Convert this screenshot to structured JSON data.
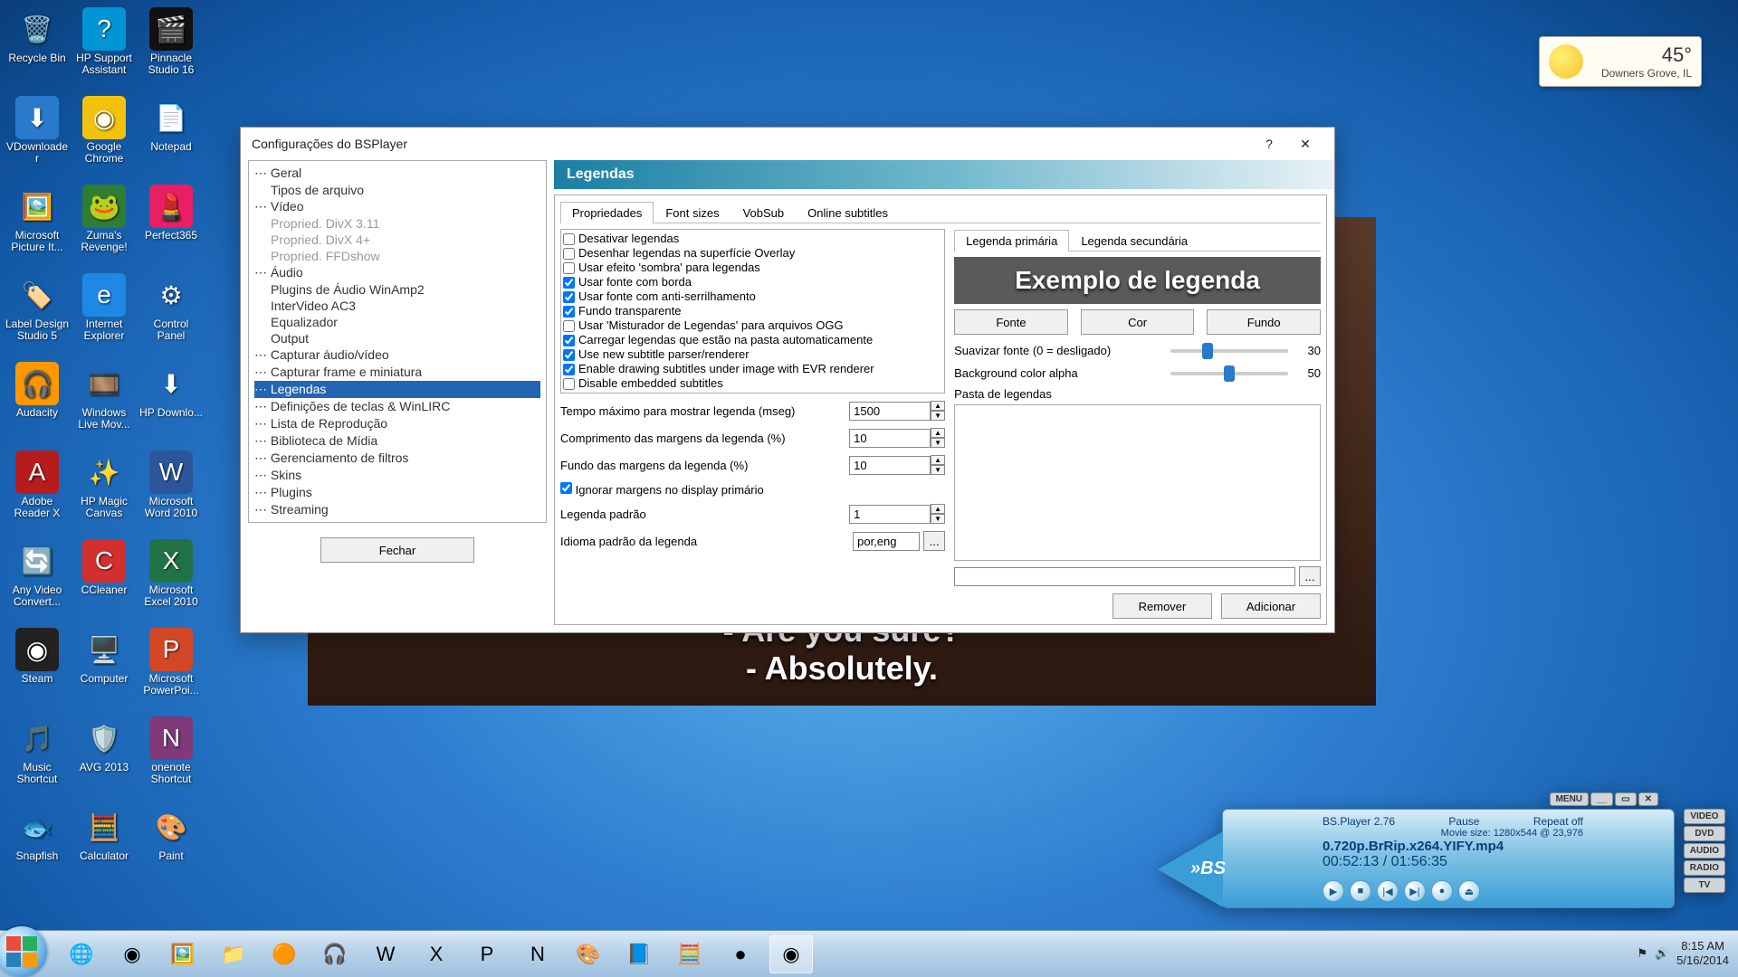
{
  "weather": {
    "temp": "45°",
    "loc": "Downers Grove, IL"
  },
  "desktop_icons": [
    {
      "label": "Recycle Bin",
      "glyph": "🗑️",
      "bg": ""
    },
    {
      "label": "HP Support Assistant",
      "glyph": "?",
      "bg": "#0096d6"
    },
    {
      "label": "Pinnacle Studio 16",
      "glyph": "🎬",
      "bg": "#111"
    },
    {
      "label": "VDownloader",
      "glyph": "⬇",
      "bg": "#2a7acc"
    },
    {
      "label": "Google Chrome",
      "glyph": "◉",
      "bg": "#f4c20d"
    },
    {
      "label": "Notepad",
      "glyph": "📄",
      "bg": ""
    },
    {
      "label": "Microsoft Picture It...",
      "glyph": "🖼️",
      "bg": ""
    },
    {
      "label": "Zuma's Revenge!",
      "glyph": "🐸",
      "bg": "#2e7d32"
    },
    {
      "label": "Perfect365",
      "glyph": "💄",
      "bg": "#e91e63"
    },
    {
      "label": "Label Design Studio 5",
      "glyph": "🏷️",
      "bg": ""
    },
    {
      "label": "Internet Explorer",
      "glyph": "e",
      "bg": "#1e88e5"
    },
    {
      "label": "Control Panel",
      "glyph": "⚙",
      "bg": ""
    },
    {
      "label": "Audacity",
      "glyph": "🎧",
      "bg": "#ff9800"
    },
    {
      "label": "Windows Live Mov...",
      "glyph": "🎞️",
      "bg": ""
    },
    {
      "label": "HP Downlo...",
      "glyph": "⬇",
      "bg": ""
    },
    {
      "label": "Adobe Reader X",
      "glyph": "A",
      "bg": "#b71c1c"
    },
    {
      "label": "HP Magic Canvas",
      "glyph": "✨",
      "bg": ""
    },
    {
      "label": "Microsoft Word 2010",
      "glyph": "W",
      "bg": "#2b579a"
    },
    {
      "label": "Any Video Convert...",
      "glyph": "🔄",
      "bg": ""
    },
    {
      "label": "CCleaner",
      "glyph": "C",
      "bg": "#d32f2f"
    },
    {
      "label": "Microsoft Excel 2010",
      "glyph": "X",
      "bg": "#217346"
    },
    {
      "label": "Steam",
      "glyph": "◉",
      "bg": "#222"
    },
    {
      "label": "Computer",
      "glyph": "🖥️",
      "bg": ""
    },
    {
      "label": "Microsoft PowerPoi...",
      "glyph": "P",
      "bg": "#d24726"
    },
    {
      "label": "Music Shortcut",
      "glyph": "🎵",
      "bg": ""
    },
    {
      "label": "AVG 2013",
      "glyph": "🛡️",
      "bg": ""
    },
    {
      "label": "onenote Shortcut",
      "glyph": "N",
      "bg": "#80397b"
    },
    {
      "label": "Snapfish",
      "glyph": "🐟",
      "bg": ""
    },
    {
      "label": "Calculator",
      "glyph": "🧮",
      "bg": ""
    },
    {
      "label": "Paint",
      "glyph": "🎨",
      "bg": ""
    }
  ],
  "video": {
    "sub1": "- Are you sure?",
    "sub2": "- Absolutely."
  },
  "dialog": {
    "title": "Configurações do BSPlayer",
    "help": "?",
    "close": "✕",
    "tree": [
      {
        "t": "Geral",
        "i": 0
      },
      {
        "t": "Tipos de arquivo",
        "i": 1
      },
      {
        "t": "Vídeo",
        "i": 0
      },
      {
        "t": "Propried. DivX 3.11",
        "i": 1,
        "d": 1
      },
      {
        "t": "Propried. DivX 4+",
        "i": 1,
        "d": 1
      },
      {
        "t": "Propried. FFDshow",
        "i": 1,
        "d": 1
      },
      {
        "t": "Áudio",
        "i": 0
      },
      {
        "t": "Plugins de Áudio WinAmp2",
        "i": 1
      },
      {
        "t": "InterVideo AC3",
        "i": 1
      },
      {
        "t": "Equalizador",
        "i": 1
      },
      {
        "t": "Output",
        "i": 1
      },
      {
        "t": "Capturar áudio/vídeo",
        "i": 0
      },
      {
        "t": "Capturar frame e miniatura",
        "i": 0
      },
      {
        "t": "Legendas",
        "i": 0,
        "sel": 1
      },
      {
        "t": "Definições de teclas & WinLIRC",
        "i": 0
      },
      {
        "t": "Lista de Reprodução",
        "i": 0
      },
      {
        "t": "Biblioteca de Mídia",
        "i": 0
      },
      {
        "t": "Gerenciamento de filtros",
        "i": 0
      },
      {
        "t": "Skins",
        "i": 0
      },
      {
        "t": "Plugins",
        "i": 0
      },
      {
        "t": "Streaming",
        "i": 0
      }
    ],
    "close_btn": "Fechar",
    "banner": "Legendas",
    "tabs": [
      "Propriedades",
      "Font sizes",
      "VobSub",
      "Online subtitles"
    ],
    "checks": [
      {
        "t": "Desativar legendas",
        "c": 0
      },
      {
        "t": "Desenhar legendas na superfície Overlay",
        "c": 0
      },
      {
        "t": "Usar efeito 'sombra' para legendas",
        "c": 0
      },
      {
        "t": "Usar fonte com borda",
        "c": 1
      },
      {
        "t": "Usar fonte com anti-serrilhamento",
        "c": 1
      },
      {
        "t": "Fundo transparente",
        "c": 1
      },
      {
        "t": "Usar 'Misturador de Legendas' para arquivos OGG",
        "c": 0
      },
      {
        "t": "Carregar legendas que estão na pasta automaticamente",
        "c": 1
      },
      {
        "t": "Use new subtitle parser/renderer",
        "c": 1
      },
      {
        "t": "Enable drawing subtitles under image with EVR renderer",
        "c": 1
      },
      {
        "t": "Disable embedded subtitles",
        "c": 0
      }
    ],
    "fields": {
      "tempo": {
        "lab": "Tempo máximo para mostrar legenda (mseg)",
        "val": "1500"
      },
      "comp": {
        "lab": "Comprimento das margens da legenda (%)",
        "val": "10"
      },
      "fundo": {
        "lab": "Fundo das margens da legenda (%)",
        "val": "10"
      },
      "ignorar": {
        "lab": "Ignorar margens no display primário",
        "c": 1
      },
      "padrao": {
        "lab": "Legenda padrão",
        "val": "1"
      },
      "idioma": {
        "lab": "Idioma padrão da legenda",
        "val": "por,eng"
      }
    },
    "subtabs": [
      "Legenda primária",
      "Legenda secundária"
    ],
    "preview": "Exemplo de legenda",
    "btns": {
      "fonte": "Fonte",
      "cor": "Cor",
      "fundo": "Fundo"
    },
    "sliders": {
      "suavizar": {
        "lab": "Suavizar fonte (0 = desligado)",
        "val": "30"
      },
      "alpha": {
        "lab": "Background color alpha",
        "val": "50"
      }
    },
    "pasta": "Pasta de legendas",
    "remover": "Remover",
    "adicionar": "Adicionar",
    "browse": "..."
  },
  "player": {
    "menu": "MENU",
    "brand": "BS.Player 2.76",
    "pause": "Pause",
    "repeat": "Repeat off",
    "movie": "Movie size: 1280x544 @ 23,976",
    "title": "0.720p.BrRip.x264.YIFY.mp4",
    "time": "00:52:13 / 01:56:35",
    "side": [
      "VIDEO",
      "DVD",
      "AUDIO",
      "RADIO",
      "TV"
    ],
    "bs": "»BS"
  },
  "taskbar": {
    "time": "8:15 AM",
    "date": "5/16/2014"
  }
}
